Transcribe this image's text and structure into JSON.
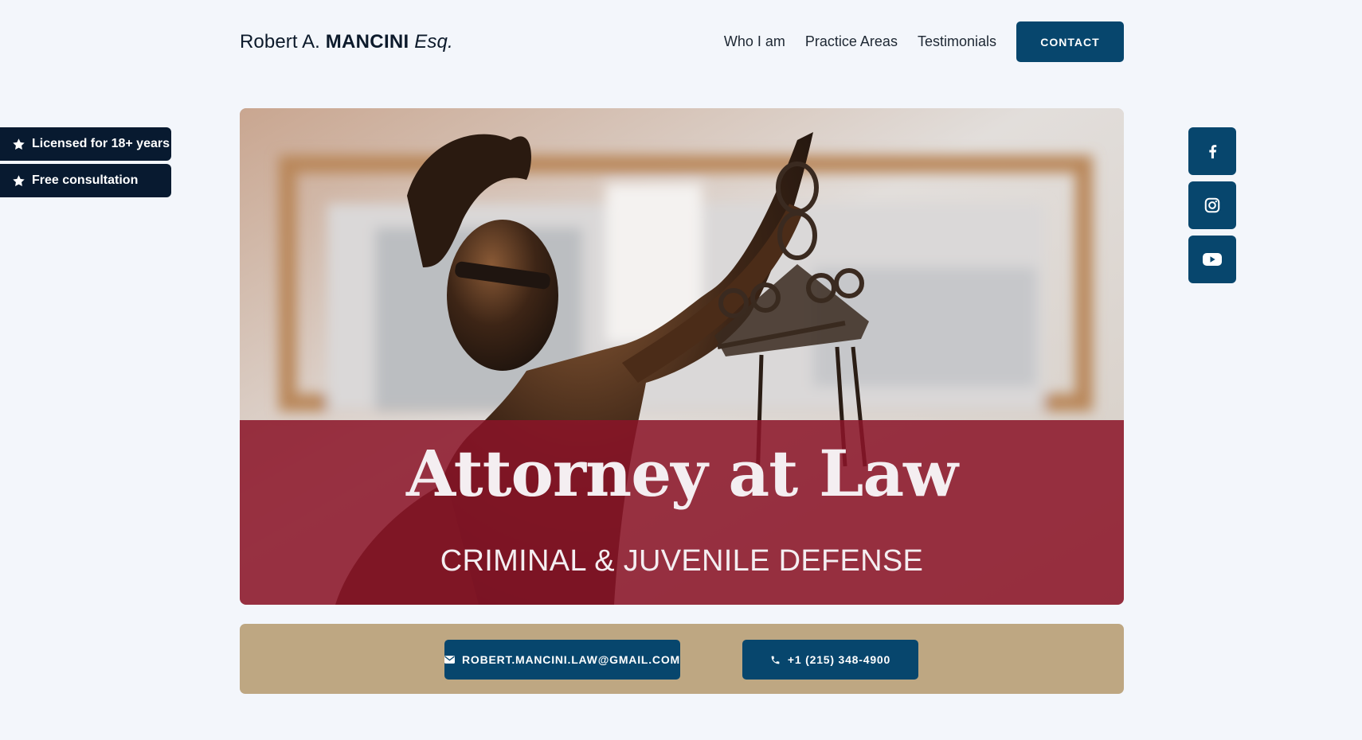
{
  "brand": {
    "first": "Robert A.",
    "last": "MANCINI",
    "suffix": "Esq."
  },
  "nav": {
    "items": [
      {
        "label": "Who I am"
      },
      {
        "label": "Practice Areas"
      },
      {
        "label": "Testimonials"
      }
    ],
    "contact_label": "CONTACT"
  },
  "badges": [
    {
      "label": "Licensed for 18+ years",
      "icon": "star-icon"
    },
    {
      "label": "Free consultation",
      "icon": "star-icon"
    }
  ],
  "social": [
    {
      "icon": "facebook-icon"
    },
    {
      "icon": "instagram-icon"
    },
    {
      "icon": "youtube-icon"
    }
  ],
  "hero": {
    "title": "Attorney at Law",
    "subtitle": "CRIMINAL & JUVENILE DEFENSE"
  },
  "contact_strip": {
    "email": "ROBERT.MANCINI.LAW@GMAIL.COM",
    "phone": "+1 (215) 348-4900"
  },
  "colors": {
    "navy": "#07466d",
    "dark_navy": "#081a30",
    "crimson_band": "#8a1428",
    "tan": "#bea782",
    "background": "#f3f6fb"
  }
}
